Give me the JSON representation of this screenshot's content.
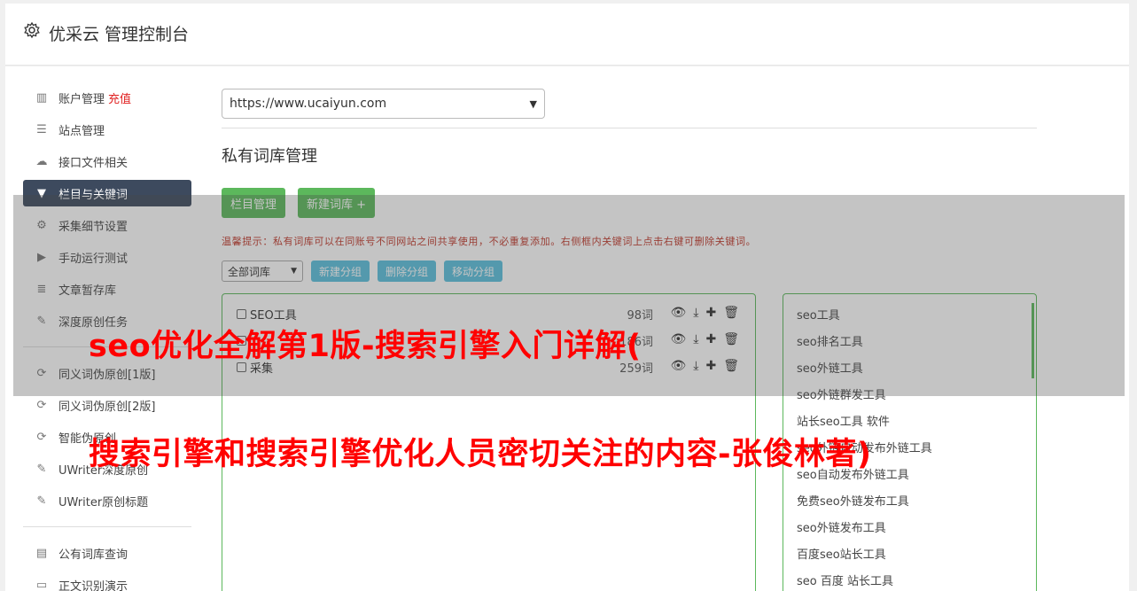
{
  "header": {
    "title": "优采云 管理控制台"
  },
  "sidebar": {
    "items": [
      {
        "label": "账户管理",
        "extra": "充值"
      },
      {
        "label": "站点管理"
      },
      {
        "label": "接口文件相关"
      },
      {
        "label": "栏目与关键词"
      },
      {
        "label": "采集细节设置"
      },
      {
        "label": "手动运行测试"
      },
      {
        "label": "文章暂存库"
      },
      {
        "label": "深度原创任务"
      },
      {
        "label": "同义词伪原创[1版]"
      },
      {
        "label": "同义词伪原创[2版]"
      },
      {
        "label": "智能伪原创"
      },
      {
        "label": "UWriter深度原创"
      },
      {
        "label": "UWriter原创标题"
      },
      {
        "label": "公有词库查询"
      },
      {
        "label": "正文识别演示"
      }
    ]
  },
  "main": {
    "site_select": "https://www.ucaiyun.com",
    "section_title": "私有词库管理",
    "btn_column": "栏目管理",
    "btn_new_lib": "新建词库 +",
    "tip": "温馨提示：私有词库可以在同账号不同网站之间共享使用，不必重复添加。右侧框内关键词上点击右键可删除关键词。",
    "lib_select": "全部词库",
    "btn_new_group": "新建分组",
    "btn_delete_group": "删除分组",
    "btn_move_group": "移动分组",
    "libraries": [
      {
        "name": "SEO工具",
        "count": "98词"
      },
      {
        "name": "",
        "count": "186词"
      },
      {
        "name": "采集",
        "count": "259词"
      }
    ],
    "keywords": [
      "seo工具",
      "seo排名工具",
      "seo外链工具",
      "seo外链群发工具",
      "站长seo工具 软件",
      "seo外链自动发布外链工具",
      "seo自动发布外链工具",
      "免费seo外链发布工具",
      "seo外链发布工具",
      "百度seo站长工具",
      "seo 百度 站长工具"
    ]
  },
  "overlay": {
    "line1": "seo优化全解第1版-搜索引擎入门详解(",
    "line2": "搜索引擎和搜索引擎优化人员密切关注的内容-张俊林著)"
  }
}
